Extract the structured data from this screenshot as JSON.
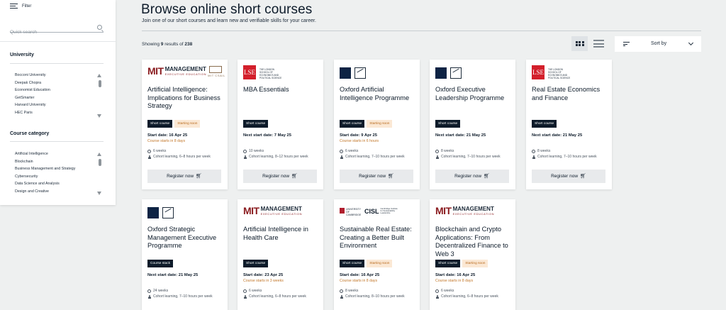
{
  "sidebar": {
    "filter_label": "Filter",
    "search_placeholder": "Quick search",
    "university": {
      "title": "University",
      "items": [
        "Bocconi University",
        "Deepak Chopra",
        "Economist Education",
        "GetSmarter",
        "Harvard University",
        "HEC Paris"
      ]
    },
    "category": {
      "title": "Course category",
      "items": [
        "Artificial Intelligence",
        "Blockchain",
        "Business Management and Strategy",
        "Cybersecurity",
        "Data Science and Analysis",
        "Design and Creative"
      ]
    }
  },
  "header": {
    "title": "Browse online short courses",
    "subtitle": "Join one of our short courses and learn new and verifiable skills for your career.",
    "showing_prefix": "Showing",
    "showing_count": "9",
    "showing_mid": "results of",
    "showing_total": "238",
    "sort_label": "Sort by"
  },
  "logos": {
    "lse": {
      "mark": "LSE",
      "text": "THE LONDON SCHOOL OF ECONOMICS AND POLITICAL SCIENCE"
    },
    "mit": {
      "mark": "MIT",
      "line1": "MANAGEMENT",
      "line2": "EXECUTIVE EDUCATION",
      "csail": "MIT CSAIL"
    },
    "oxford": {
      "text": "Saïd Business School"
    },
    "cambridge": {
      "text": "UNIVERSITY OF CAMBRIDGE",
      "cisl": "CISL",
      "cisl_text": "Cambridge Institute for Sustainability Leadership"
    }
  },
  "courses": [
    {
      "title": "Artificial Intelligence: Implications for Business Strategy",
      "badge": "Short course",
      "soon": "Starting soon",
      "start": "Start date: 16 Apr 25",
      "starts_in": "Course starts in 8 days",
      "duration": "6 weeks",
      "effort": "Cohort learning, 6–8 hours per week",
      "button": "Register now"
    },
    {
      "title": "MBA Essentials",
      "badge": "Short course",
      "start": "Next start date: 7 May 25",
      "duration": "10 weeks",
      "effort": "Cohort learning, 8–12 hours per week",
      "button": "Register now"
    },
    {
      "title": "Oxford Artificial Intelligence Programme",
      "badge": "Short course",
      "soon": "Starting soon",
      "start": "Start date: 9 Apr 25",
      "starts_in": "Course starts in 6 hours",
      "duration": "6 weeks",
      "effort": "Cohort learning, 7–10 hours per week",
      "button": "Register now"
    },
    {
      "title": "Oxford Executive Leadership Programme",
      "badge": "Short course",
      "start": "Next start date: 21 May 25",
      "duration": "8 weeks",
      "effort": "Cohort learning, 7–10 hours per week",
      "button": "Register now"
    },
    {
      "title": "Real Estate Economics and Finance",
      "badge": "Short course",
      "start": "Next start date: 21 May 25",
      "duration": "8 weeks",
      "effort": "Cohort learning, 7–10 hours per week",
      "button": "Register now"
    },
    {
      "title": "Oxford Strategic Management Executive Programme",
      "badge": "Course stack",
      "start": "Next start date: 21 May 25",
      "duration": "24 weeks",
      "effort": "Cohort learning, 7–10 hours per week"
    },
    {
      "title": "Artificial Intelligence in Health Care",
      "badge": "Short course",
      "start": "Start date: 23 Apr 25",
      "starts_in": "Course starts in 3 weeks",
      "duration": "6 weeks",
      "effort": "Cohort learning, 6–8 hours per week"
    },
    {
      "title": "Sustainable Real Estate: Creating a Better Built Environment",
      "badge": "Short course",
      "soon": "Starting soon",
      "start": "Start date: 16 Apr 25",
      "starts_in": "Course starts in 8 days",
      "duration": "8 weeks",
      "effort": "Cohort learning, 8–10 hours per week"
    },
    {
      "title": "Blockchain and Crypto Applications: From Decentralized Finance to Web 3",
      "badge": "Short course",
      "soon": "Starting soon",
      "start": "Start date: 16 Apr 25",
      "starts_in": "Course starts in 8 days",
      "duration": "6 weeks",
      "effort": "Cohort learning, 6–8 hours per week"
    }
  ]
}
